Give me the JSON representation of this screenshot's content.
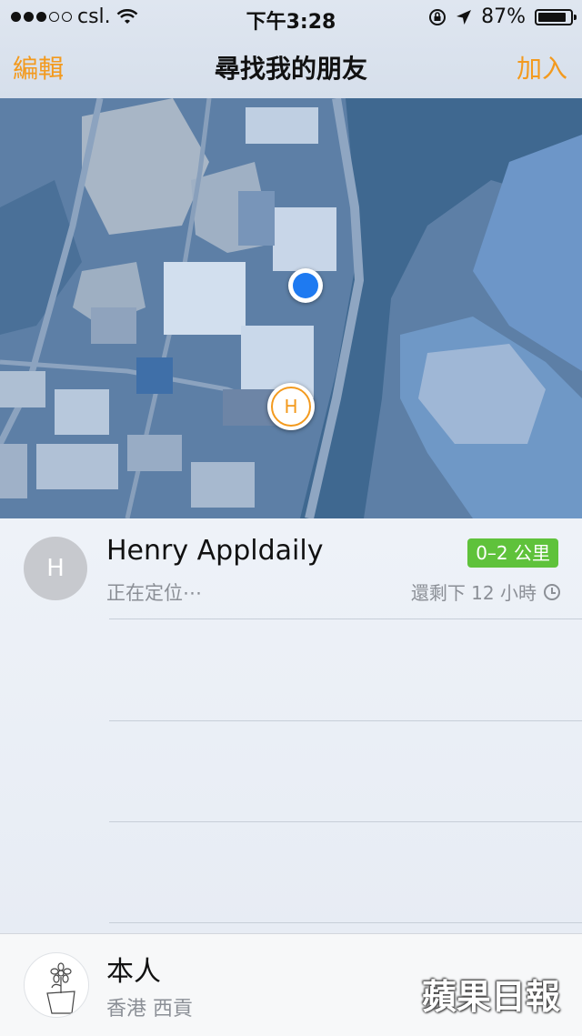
{
  "status_bar": {
    "carrier": "csl.",
    "time": "下午3:28",
    "battery_percent_label": "87%",
    "battery_level": 0.87
  },
  "nav": {
    "edit_label": "編輯",
    "title": "尋找我的朋友",
    "add_label": "加入"
  },
  "map": {
    "friend_pin_letter": "H"
  },
  "friends": [
    {
      "avatar_letter": "H",
      "name": "Henry Appldaily",
      "status": "正在定位⋯",
      "distance": "0–2 公里",
      "remaining": "還剩下 12 小時"
    }
  ],
  "me": {
    "name": "本人",
    "location": "香港 西貢"
  },
  "watermark": "蘋果日報",
  "colors": {
    "accent": "#f39a1e",
    "badge_green": "#5fc23b",
    "location_blue": "#1e7af1"
  }
}
